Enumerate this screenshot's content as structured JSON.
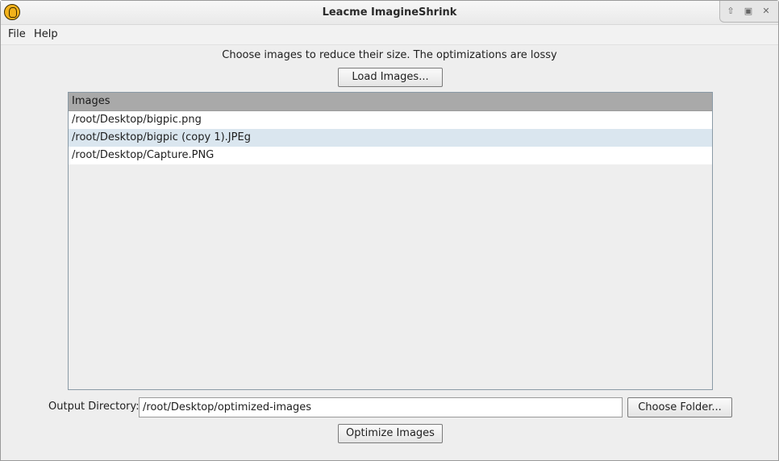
{
  "window": {
    "title": "Leacme ImagineShrink",
    "controls": {
      "up_icon": "⇧",
      "maximize_icon": "▣",
      "close_icon": "✕"
    }
  },
  "menu": {
    "file": "File",
    "help": "Help"
  },
  "main": {
    "subtitle": "Choose images to reduce their size. The optimizations are lossy",
    "load_button": "Load Images...",
    "list": {
      "header": "Images",
      "rows": [
        "/root/Desktop/bigpic.png",
        "/root/Desktop/bigpic (copy 1).JPEg",
        "/root/Desktop/Capture.PNG"
      ]
    },
    "output": {
      "label": "Output Directory:",
      "value": "/root/Desktop/optimized-images",
      "choose_button": "Choose Folder..."
    },
    "optimize_button": "Optimize Images"
  }
}
